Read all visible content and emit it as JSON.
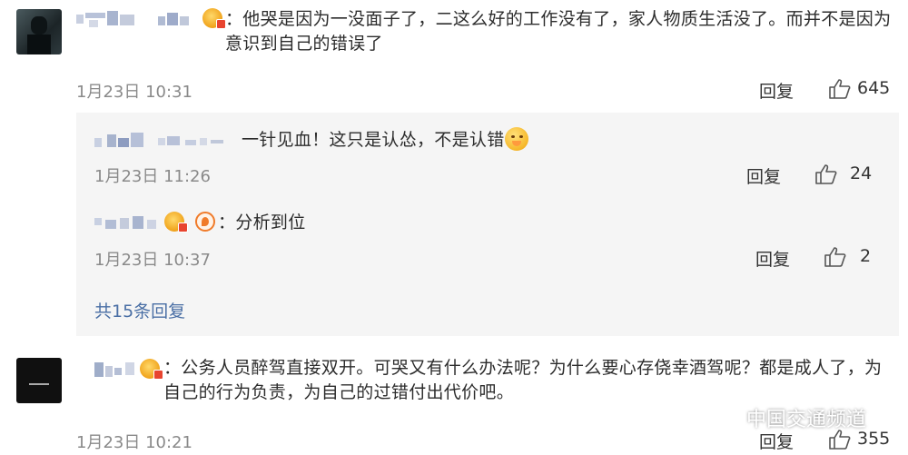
{
  "comments": [
    {
      "text": "：他哭是因为一没面子了，二这么好的工作没有了，家人物质生活没了。而并不是因为意识到自己的错误了",
      "time": "1月23日 10:31",
      "reply_label": "回复",
      "likes": "645"
    },
    {
      "text": "：公务人员醉驾直接双开。可哭又有什么办法呢？为什么要心存侥幸酒驾呢？都是成人了，为自己的行为负责，为自己的过错付出代价吧。",
      "time": "1月23日 10:21",
      "reply_label": "回复",
      "likes": "355"
    }
  ],
  "replies": [
    {
      "text": "一针见血！这只是认怂，不是认错",
      "time": "1月23日 11:26",
      "reply_label": "回复",
      "likes": "24"
    },
    {
      "text": "：分析到位",
      "time": "1月23日 10:37",
      "reply_label": "回复",
      "likes": "2"
    }
  ],
  "more_replies": "共15条回复",
  "watermark": "中国交通频道",
  "icons": {
    "like": "thumbs-up-icon",
    "vip": "vip-badge-icon",
    "emoji": "sweat-smile-emoji",
    "watermark": "wechat-icon"
  },
  "colors": {
    "link": "#4a6fa5",
    "meta": "#8a8a8a",
    "panel": "#f5f5f5"
  }
}
